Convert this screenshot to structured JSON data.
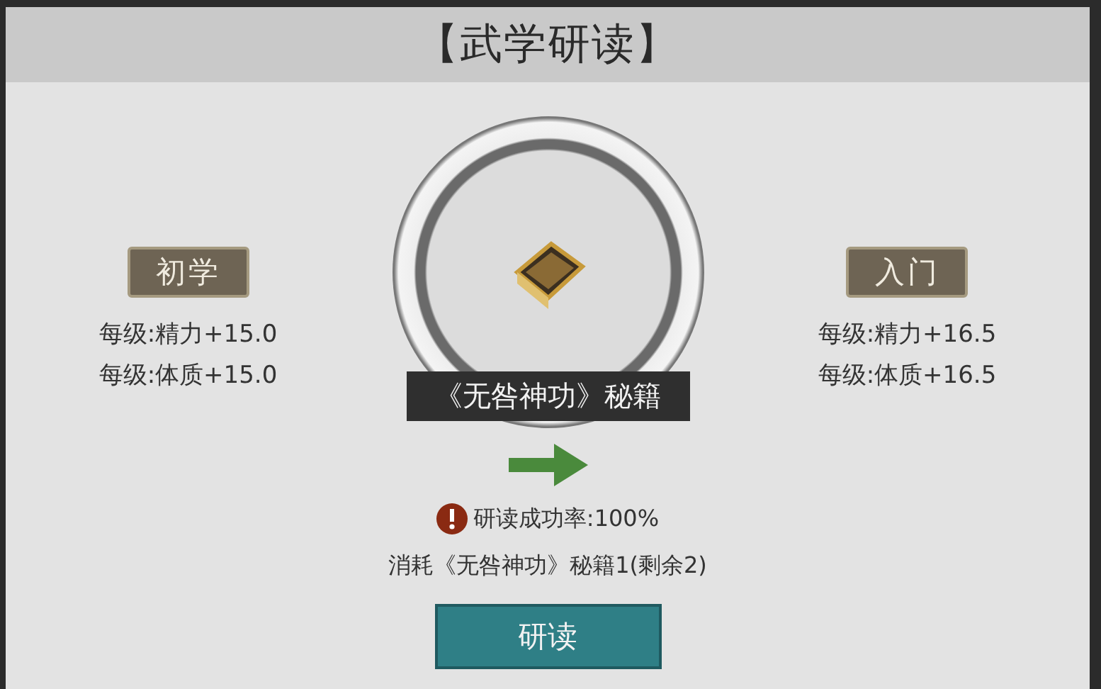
{
  "title": "【武学研读】",
  "current": {
    "rank": "初学",
    "stats": [
      "每级:精力+15.0",
      "每级:体质+15.0"
    ]
  },
  "next": {
    "rank": "入门",
    "stats": [
      "每级:精力+16.5",
      "每级:体质+16.5"
    ]
  },
  "item": {
    "name": "《无咎神功》秘籍"
  },
  "success_rate": "研读成功率:100%",
  "cost": "消耗《无咎神功》秘籍1(剩余2)",
  "button": "研读"
}
